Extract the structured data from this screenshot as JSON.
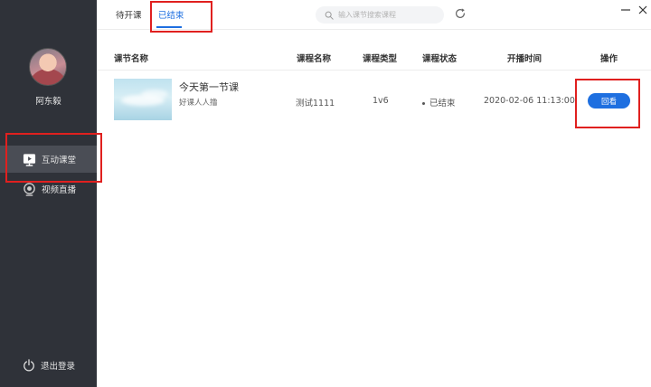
{
  "user": {
    "name": "阿东毅"
  },
  "sidebar": {
    "items": [
      {
        "label": "互动课堂",
        "icon": "play-board-icon",
        "active": true
      },
      {
        "label": "视频直播",
        "icon": "camera-icon",
        "active": false
      }
    ],
    "logout_label": "退出登录"
  },
  "tabs": [
    {
      "label": "待开课",
      "active": false
    },
    {
      "label": "已结束",
      "active": true
    }
  ],
  "search": {
    "placeholder": "输入课节搜索课程"
  },
  "table": {
    "headers": [
      "课节名称",
      "课程名称",
      "课程类型",
      "课程状态",
      "开播时间",
      "操作"
    ],
    "rows": [
      {
        "title": "今天第一节课",
        "subtitle": "好课人人撸",
        "course": "测试1111",
        "type": "1v6",
        "status": "已结束",
        "time": "2020-02-06 11:13:00",
        "action": "回看"
      }
    ]
  },
  "colors": {
    "accent": "#1e6fe0",
    "sidebar": "#2f3239",
    "highlight": "#e0201f"
  }
}
